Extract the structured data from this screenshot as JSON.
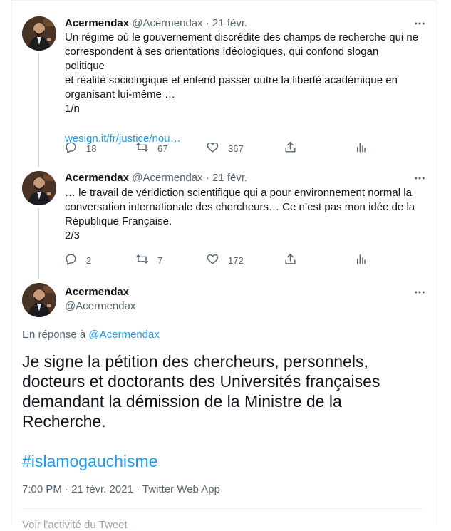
{
  "tweets": [
    {
      "author_name": "Acermendax",
      "handle": "@Acermendax",
      "sep": "·",
      "date": "21 févr.",
      "lines": [
        "Un régime où le gouvernement discrédite des champs de recherche qui ne",
        "correspondent à ses orientations idéologiques, qui confond slogan politique",
        "et réalité sociologique et entend passer outre la liberté académique en",
        "organisant lui-même …",
        "1/n"
      ],
      "link": "wesign.it/fr/justice/nou…",
      "replies": "18",
      "retweets": "67",
      "likes": "367"
    },
    {
      "author_name": "Acermendax",
      "handle": "@Acermendax",
      "sep": "·",
      "date": "21 févr.",
      "lines": [
        "… le travail de véridiction scientifique qui a pour environnement normal la",
        "conversation internationale des chercheurs… Ce n’est pas mon idée de la",
        "République Française.",
        "2/3"
      ],
      "replies": "2",
      "retweets": "7",
      "likes": "172"
    }
  ],
  "main": {
    "author_name": "Acermendax",
    "handle": "@Acermendax",
    "reply_prefix": "En réponse à",
    "reply_to": "@Acermendax",
    "lines": [
      "Je signe la pétition des chercheurs, personnels,",
      "docteurs et doctorants des Universités françaises",
      "demandant la démission de la Ministre de la",
      "Recherche."
    ],
    "hashtag": "#islamogauchisme",
    "meta": "7:00 PM · 21 févr. 2021 · Twitter Web App",
    "clipped_footer": "Voir l'activité du Tweet"
  },
  "icons": {
    "more": "more-icon",
    "reply": "reply-icon",
    "retweet": "retweet-icon",
    "like": "like-icon",
    "share": "share-icon",
    "analytics": "analytics-icon"
  },
  "colors": {
    "accent": "#1d9bf0",
    "muted": "#536471",
    "text": "#0f1419",
    "thread_line": "#cfd9de"
  }
}
